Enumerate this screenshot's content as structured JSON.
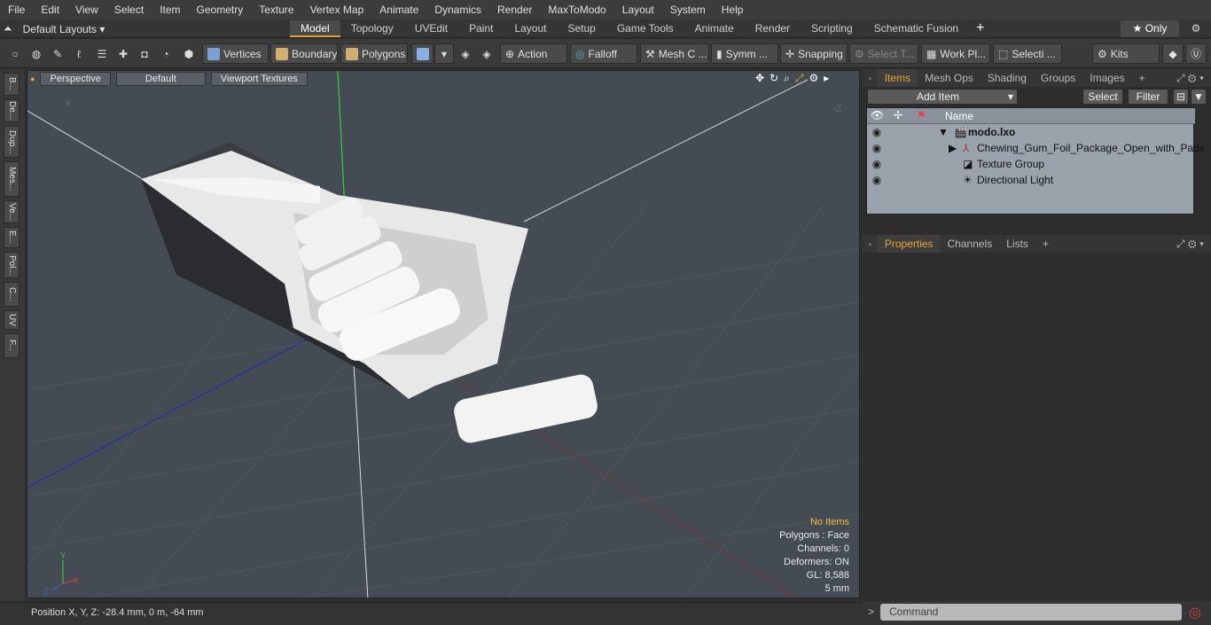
{
  "menu": [
    "File",
    "Edit",
    "View",
    "Select",
    "Item",
    "Geometry",
    "Texture",
    "Vertex Map",
    "Animate",
    "Dynamics",
    "Render",
    "MaxToModo",
    "Layout",
    "System",
    "Help"
  ],
  "layouts": {
    "label": "Default Layouts ▾"
  },
  "tabs": [
    "Model",
    "Topology",
    "UVEdit",
    "Paint",
    "Layout",
    "Setup",
    "Game Tools",
    "Animate",
    "Render",
    "Scripting",
    "Schematic Fusion"
  ],
  "tabs_active": "Model",
  "only_label": "★  Only",
  "toolbar": {
    "vertices": "Vertices",
    "boundary": "Boundary",
    "polygons": "Polygons",
    "action": "Action",
    "falloff": "Falloff",
    "mesh": "Mesh C ...",
    "symm": "Symm ...",
    "snapping": "Snapping",
    "select_t": "Select T...",
    "work": "Work Pl...",
    "selecti": "Selecti ...",
    "kits": "Kits"
  },
  "left_tabs": [
    "B...",
    "De...",
    "Dup...",
    "Mes...",
    "Ve...",
    "E...",
    "Pol...",
    "C...",
    "UV",
    "F..."
  ],
  "viewport": {
    "view": "Perspective",
    "shading": "Default",
    "textures": "Viewport Textures",
    "axis_x": "X",
    "axis_y": "Y",
    "axis_z": "Z",
    "corner_x": "X",
    "corner_z": "-Z"
  },
  "stats": {
    "items": "No Items",
    "polygons": "Polygons : Face",
    "channels": "Channels: 0",
    "deformers": "Deformers: ON",
    "gl": "GL: 8,588",
    "scale": "5 mm"
  },
  "status": {
    "position": "Position X, Y, Z:   -28.4 mm, 0 m, -64 mm"
  },
  "items_panel": {
    "tabs": [
      "Items",
      "Mesh Ops",
      "Shading",
      "Groups",
      "Images"
    ],
    "active": "Items",
    "add_item": "Add Item",
    "select": "Select",
    "filter": "Filter",
    "col_name": "Name",
    "tree": [
      {
        "label": "modo.lxo",
        "bold": true
      },
      {
        "label": "Chewing_Gum_Foil_Package_Open_with_Pads"
      },
      {
        "label": "Texture Group"
      },
      {
        "label": "Directional Light"
      }
    ]
  },
  "props_panel": {
    "tabs": [
      "Properties",
      "Channels",
      "Lists"
    ],
    "active": "Properties"
  },
  "command": {
    "placeholder": "Command"
  },
  "colors": {
    "accent": "#e8a530",
    "viewport_bg": "#454b52",
    "tree_bg": "#9aa3ab"
  }
}
